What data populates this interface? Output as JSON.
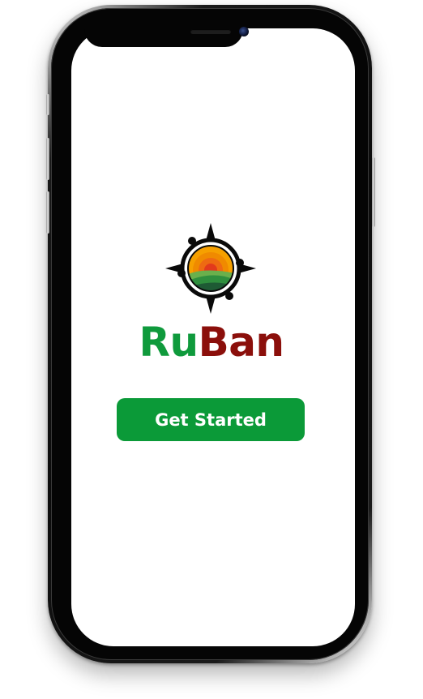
{
  "app": {
    "brand_part_1": "Ru",
    "brand_part_2": "Ban"
  },
  "cta": {
    "label": "Get Started"
  },
  "logo": {
    "icon": "compass-sunrise-logo"
  },
  "colors": {
    "brand_green": "#0f9a3c",
    "brand_red": "#8b0f0b",
    "button": "#0b9a38",
    "button_text": "#ffffff",
    "screen_bg": "#ffffff"
  }
}
